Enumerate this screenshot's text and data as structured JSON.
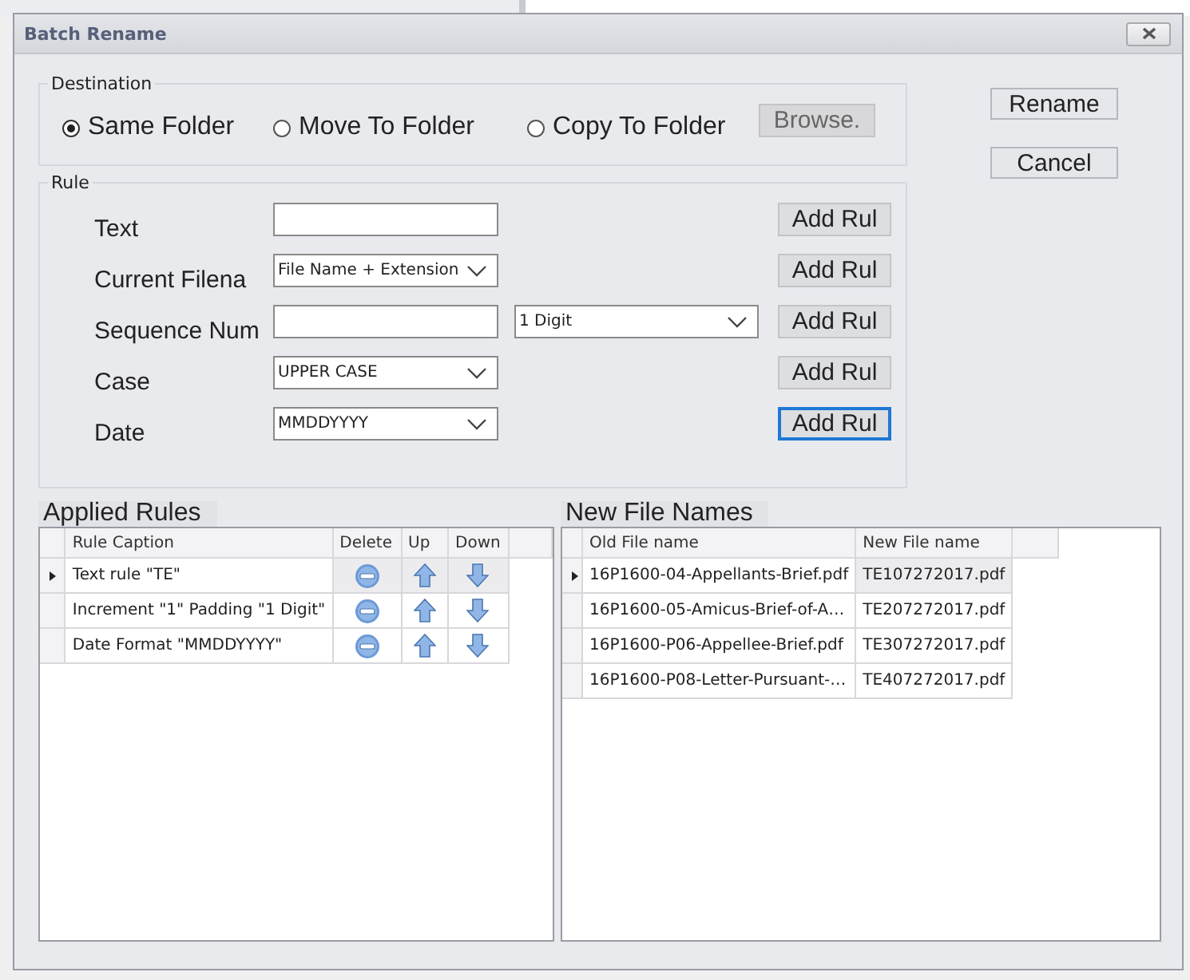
{
  "window": {
    "title": "Batch Rename"
  },
  "destination": {
    "title": "Destination",
    "options": [
      {
        "label": "Same Folder",
        "selected": true
      },
      {
        "label": "Move To Folder",
        "selected": false
      },
      {
        "label": "Copy To Folder",
        "selected": false
      }
    ],
    "browse_button": "Browse."
  },
  "actions": [
    "Rename",
    "Cancel"
  ],
  "rule": {
    "title": "Rule",
    "rows": [
      {
        "label": "Text",
        "fields": [
          {
            "kind": "text"
          }
        ],
        "add_button": {
          "label": "Add Rul",
          "focused": false
        }
      },
      {
        "label": "Current Filena",
        "fields": [
          {
            "kind": "dropdown",
            "value": "File Name + Extension"
          }
        ],
        "add_button": {
          "label": "Add Rul",
          "focused": false
        }
      },
      {
        "label": "Sequence Num",
        "fields": [
          {
            "kind": "text"
          },
          {
            "kind": "dropdown",
            "value": "1 Digit"
          }
        ],
        "add_button": {
          "label": "Add Rul",
          "focused": false
        }
      },
      {
        "label": "Case",
        "fields": [
          {
            "kind": "dropdown",
            "value": "UPPER CASE"
          }
        ],
        "add_button": {
          "label": "Add Rul",
          "focused": false
        }
      },
      {
        "label": "Date",
        "fields": [
          {
            "kind": "dropdown",
            "value": "MMDDYYYY"
          }
        ],
        "add_button": {
          "label": "Add Rul",
          "focused": true
        }
      }
    ]
  },
  "applied_rules": {
    "title": "Applied Rules",
    "columns": [
      "Rule Caption",
      "Delete",
      "Up",
      "Down"
    ],
    "rows": [
      {
        "caption": "Text rule \"TE\"",
        "selected": true
      },
      {
        "caption": "Increment \"1\" Padding \"1 Digit\"",
        "selected": false
      },
      {
        "caption": "Date Format \"MMDDYYYY\"",
        "selected": false
      }
    ]
  },
  "new_file_names": {
    "title": "New File Names",
    "columns": [
      "Old File name",
      "New File name"
    ],
    "rows": [
      {
        "old": "16P1600-04-Appellants-Brief.pdf",
        "new": "TE107272017.pdf",
        "selected": true
      },
      {
        "old": "16P1600-05-Amicus-Brief-of-A…",
        "new": "TE207272017.pdf",
        "selected": false
      },
      {
        "old": "16P1600-P06-Appellee-Brief.pdf",
        "new": "TE307272017.pdf",
        "selected": false
      },
      {
        "old": "16P1600-P08-Letter-Pursuant-…",
        "new": "TE407272017.pdf",
        "selected": false
      }
    ]
  }
}
